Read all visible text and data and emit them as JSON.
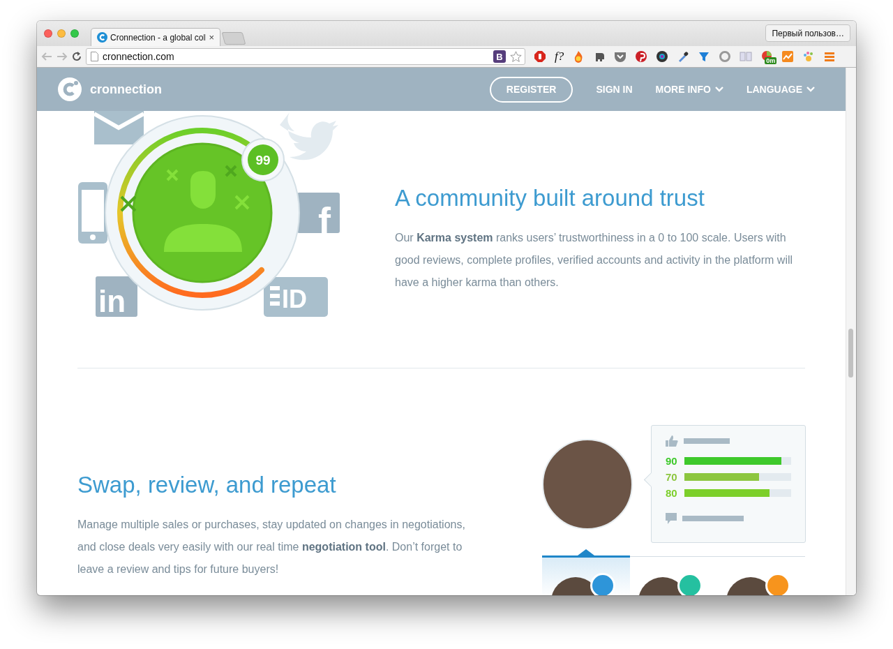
{
  "browser": {
    "tab_title": "Cronnection - a global coll",
    "tab_close": "×",
    "profile": "Первый пользов…",
    "url": "cronnection.com",
    "bookmark_badge": "B",
    "extension_text": "f?",
    "extension_badge": "0m"
  },
  "nav": {
    "brand": "cronnection",
    "register": "REGISTER",
    "sign_in": "SIGN IN",
    "menus": [
      "MORE INFO",
      "LANGUAGE"
    ]
  },
  "karma": {
    "score": "99",
    "facebook": "f",
    "linkedin": "in",
    "id_card": "ID",
    "title": "A community built around trust",
    "text": "Our **Karma system** ranks users’ trustworthiness in a 0 to 100 scale. Users with good reviews, complete profiles, verified accounts and activity in the platform will have a higher karma than others."
  },
  "swap": {
    "title": "Swap, review, and repeat",
    "text": "Manage multiple sales or purchases, stay updated on changes in negotiations, and close deals very easily with our real time **negotiation tool**. Don’t forget to leave a review and tips for future buyers!",
    "ratings": [
      {
        "value": "90",
        "level": 0.91,
        "color": "#3ec92b"
      },
      {
        "value": "70",
        "level": 0.7,
        "color": "#8cc63f"
      },
      {
        "value": "80",
        "level": 0.8,
        "color": "#7ccf2a"
      }
    ],
    "tabs": [
      {
        "selected": true,
        "color": "#2e95d9"
      },
      {
        "selected": false,
        "color": "#25c0a0"
      },
      {
        "selected": false,
        "color": "#f7941d"
      }
    ]
  }
}
